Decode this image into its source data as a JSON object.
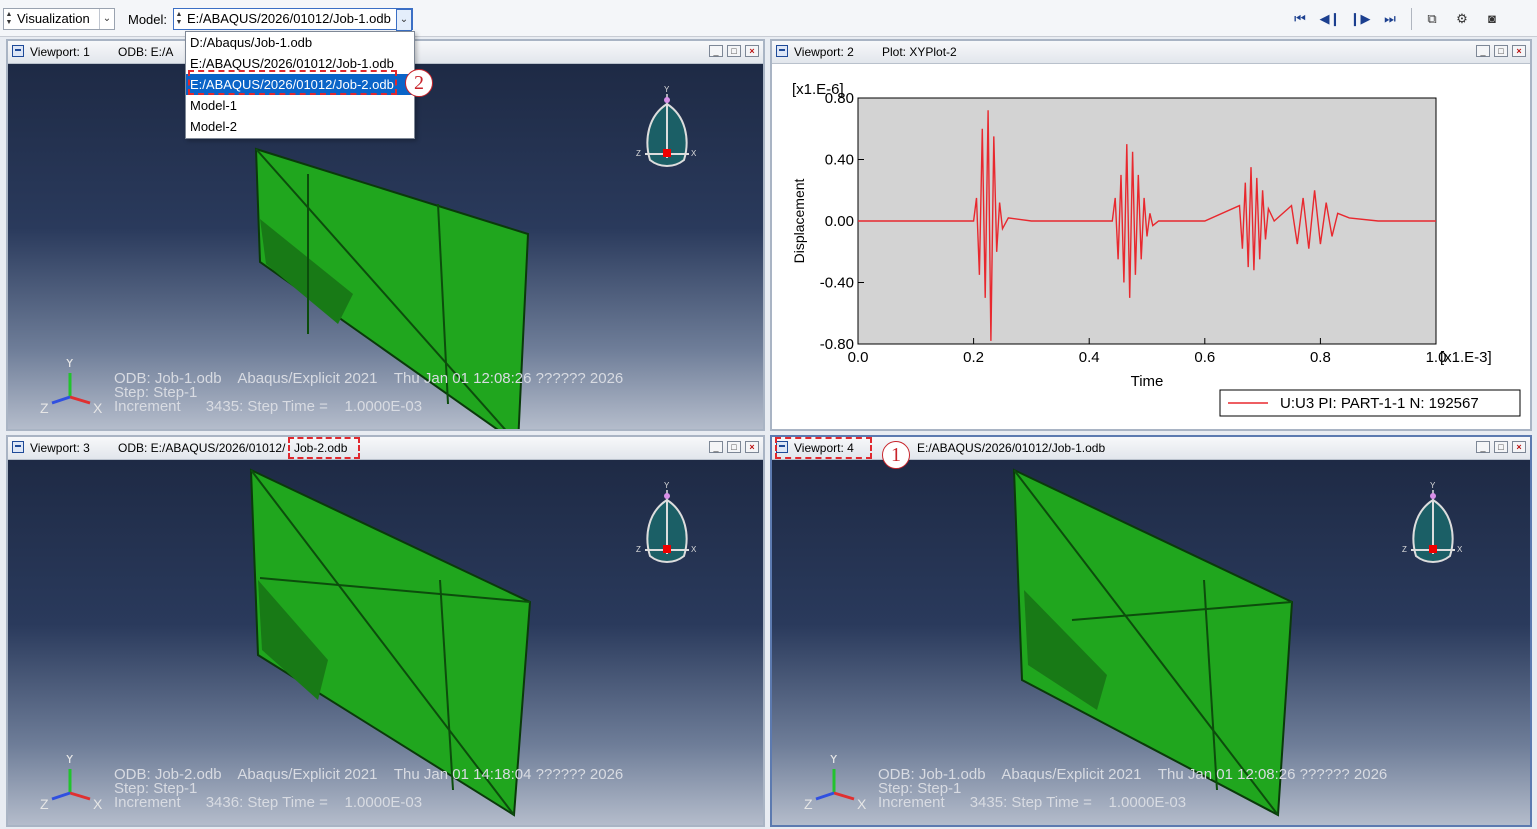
{
  "toolbar": {
    "module_label": "Visualization",
    "model_label": "Model:",
    "model_value": "E:/ABAQUS/2026/01012/Job-1.odb"
  },
  "model_dropdown": {
    "items": [
      "D:/Abaqus/Job-1.odb",
      "E:/ABAQUS/2026/01012/Job-1.odb",
      "E:/ABAQUS/2026/01012/Job-2.odb",
      "Model-1",
      "Model-2"
    ],
    "selected": "E:/ABAQUS/2026/01012/Job-2.odb"
  },
  "callouts": {
    "one": "1",
    "two": "2"
  },
  "triad": {
    "y": "Y",
    "z": "Z",
    "x": "X"
  },
  "viewports": [
    {
      "name": "Viewport: 1",
      "subtitle": "ODB: E:/A",
      "info": {
        "line1": "ODB: Job-1.odb    Abaqus/Explicit 2021    Thu Jan 01 12:08:26 ?????? 2026",
        "line2": "Step: Step-1",
        "line3": "Increment      3435: Step Time =    1.0000E-03"
      }
    },
    {
      "name": "Viewport: 2",
      "subtitle": "Plot: XYPlot-2"
    },
    {
      "name": "Viewport: 3",
      "subtitle_prefix": "ODB: E:/ABAQUS/2026/01012/",
      "subtitle_highlight": "Job-2.odb",
      "info": {
        "line1": "ODB: Job-2.odb    Abaqus/Explicit 2021    Thu Jan 01 14:18:04 ?????? 2026",
        "line2": "Step: Step-1",
        "line3": "Increment      3436: Step Time =    1.0000E-03"
      }
    },
    {
      "name": "Viewport: 4",
      "subtitle": "E:/ABAQUS/2026/01012/Job-1.odb",
      "info": {
        "line1": "ODB: Job-1.odb    Abaqus/Explicit 2021    Thu Jan 01 12:08:26 ?????? 2026",
        "line2": "Step: Step-1",
        "line3": "Increment      3435: Step Time =    1.0000E-03"
      }
    }
  ],
  "chart_data": {
    "type": "line",
    "xlabel": "Time",
    "ylabel": "Displacement",
    "x_scale_label": "[x1.E-3]",
    "y_scale_label": "[x1.E-6]",
    "xlim": [
      0.0,
      1.0
    ],
    "ylim": [
      -0.8,
      0.8
    ],
    "x_ticks": [
      "0.0",
      "0.2",
      "0.4",
      "0.6",
      "0.8",
      "1.0"
    ],
    "y_ticks": [
      "0.80",
      "0.40",
      "0.00",
      "-0.40",
      "-0.80"
    ],
    "grid": false,
    "legend_position": "bottom-right",
    "colors": {
      "series": "#e8282e",
      "plot_bg": "#d3d3d3"
    },
    "series": [
      {
        "name": "U:U3 PI: PART-1-1 N: 192567",
        "x": [
          0.0,
          0.2,
          0.205,
          0.21,
          0.215,
          0.22,
          0.225,
          0.23,
          0.235,
          0.24,
          0.245,
          0.25,
          0.26,
          0.3,
          0.44,
          0.445,
          0.45,
          0.455,
          0.46,
          0.465,
          0.47,
          0.475,
          0.48,
          0.485,
          0.49,
          0.495,
          0.5,
          0.505,
          0.51,
          0.52,
          0.6,
          0.66,
          0.665,
          0.67,
          0.675,
          0.68,
          0.685,
          0.69,
          0.695,
          0.7,
          0.705,
          0.71,
          0.72,
          0.75,
          0.76,
          0.77,
          0.78,
          0.79,
          0.8,
          0.81,
          0.82,
          0.83,
          0.85,
          0.9,
          1.0
        ],
        "y": [
          0.0,
          0.0,
          0.15,
          -0.35,
          0.6,
          -0.5,
          0.72,
          -0.78,
          0.55,
          -0.2,
          0.12,
          -0.05,
          0.02,
          0.0,
          0.0,
          0.15,
          -0.25,
          0.3,
          -0.4,
          0.5,
          -0.5,
          0.45,
          -0.35,
          0.3,
          -0.25,
          0.15,
          -0.1,
          0.05,
          -0.03,
          0.0,
          0.0,
          0.1,
          -0.18,
          0.25,
          -0.3,
          0.35,
          -0.32,
          0.28,
          -0.25,
          0.2,
          -0.12,
          0.08,
          0.0,
          0.1,
          -0.15,
          0.15,
          -0.18,
          0.2,
          -0.15,
          0.12,
          -0.1,
          0.05,
          0.02,
          0.0,
          0.0
        ]
      }
    ]
  }
}
